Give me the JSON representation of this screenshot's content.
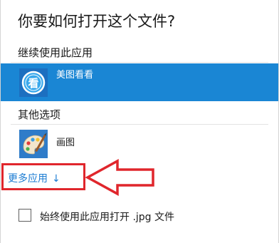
{
  "dialog": {
    "title": "你要如何打开这个文件?",
    "continue_section": "继续使用此应用",
    "current_app": {
      "name": "美图看看",
      "icon": "meitu-kankan-icon",
      "icon_glyph": "看"
    },
    "other_section": "其他选项",
    "other_apps": [
      {
        "name": "画图",
        "icon": "paint-palette-icon"
      }
    ],
    "more_apps": {
      "label": "更多应用",
      "arrow": "↓"
    },
    "always_use": {
      "label": "始终使用此应用打开 .jpg 文件",
      "checked": false
    }
  },
  "colors": {
    "selected_bg": "#1a86d4",
    "link": "#1a7bd2",
    "annotation": "#e0262c"
  }
}
